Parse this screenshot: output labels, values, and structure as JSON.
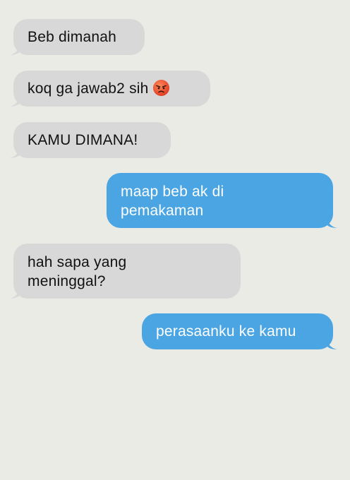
{
  "conversation": {
    "messages": [
      {
        "direction": "received",
        "lines": [
          "Beb dimanah"
        ]
      },
      {
        "direction": "received",
        "lines": [
          "koq ga jawab2 sih"
        ],
        "emoji": "angry-face-emoji"
      },
      {
        "direction": "received",
        "lines": [
          "KAMU DIMANA!"
        ]
      },
      {
        "direction": "sent",
        "lines": [
          "maap beb ak di",
          "pemakaman"
        ]
      },
      {
        "direction": "received",
        "lines": [
          "hah sapa yang",
          "meninggal?"
        ]
      },
      {
        "direction": "sent",
        "lines": [
          "perasaanku ke kamu"
        ]
      }
    ]
  },
  "colors": {
    "background": "#ebebe6",
    "received_bubble": "#d8d8d8",
    "sent_bubble": "#4aa5e2",
    "received_text": "#111111",
    "sent_text": "#ffffff"
  }
}
